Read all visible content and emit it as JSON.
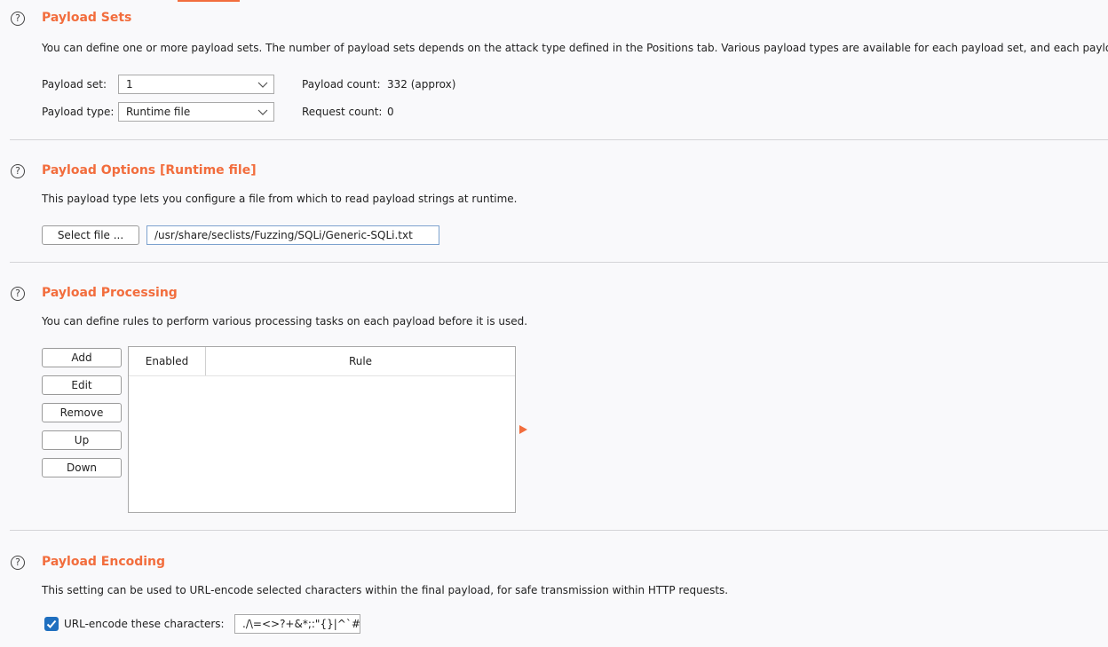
{
  "payload_sets": {
    "help_icon": "?",
    "title": "Payload Sets",
    "description": "You can define one or more payload sets. The number of payload sets depends on the attack type defined in the Positions tab. Various payload types are available for each payload set, and each payload ty",
    "set_label": "Payload set:",
    "set_value": "1",
    "type_label": "Payload type:",
    "type_value": "Runtime file",
    "count_label": "Payload count:",
    "count_value": "332 (approx)",
    "request_label": "Request count:",
    "request_value": "0"
  },
  "payload_options": {
    "help_icon": "?",
    "title": "Payload Options [Runtime file]",
    "description": "This payload type lets you configure a file from which to read payload strings at runtime.",
    "select_file_label": "Select file ...",
    "file_path": "/usr/share/seclists/Fuzzing/SQLi/Generic-SQLi.txt"
  },
  "payload_processing": {
    "help_icon": "?",
    "title": "Payload Processing",
    "description": "You can define rules to perform various processing tasks on each payload before it is used.",
    "buttons": {
      "add": "Add",
      "edit": "Edit",
      "remove": "Remove",
      "up": "Up",
      "down": "Down"
    },
    "columns": [
      "Enabled",
      "Rule"
    ],
    "accent_color": "#f26d3d"
  },
  "payload_encoding": {
    "help_icon": "?",
    "title": "Payload Encoding",
    "description": "This setting can be used to URL-encode selected characters within the final payload, for safe transmission within HTTP requests.",
    "checkbox_checked": true,
    "checkbox_label": "URL-encode these characters:",
    "characters": "./\\=<>?+&*;:\"{}|^`#",
    "checkbox_color": "#1f6fbf"
  },
  "icons": {
    "help": "help-circle-icon",
    "dropdown": "chevron-down-icon",
    "check": "checkmark-icon",
    "expand_arrow": "triangle-right-icon"
  },
  "colors": {
    "section_title": "#f26d3d",
    "background": "#f9f9fb"
  }
}
